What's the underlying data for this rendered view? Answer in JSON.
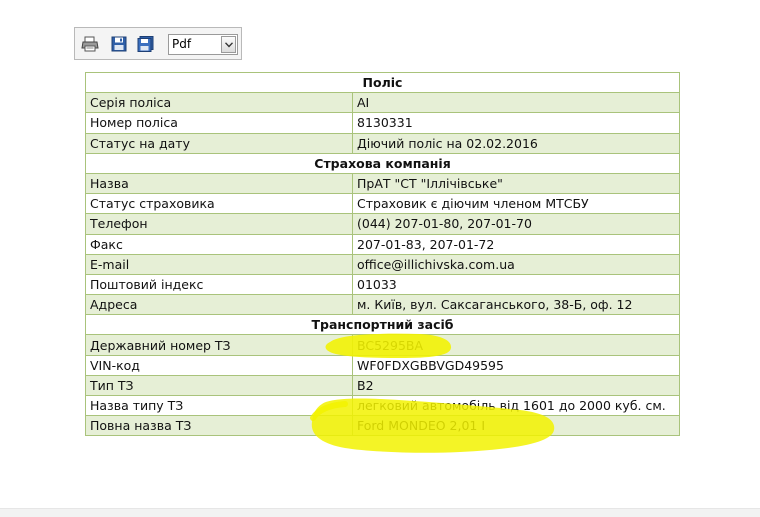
{
  "toolbar": {
    "buttons": [
      {
        "icon": "printer-icon"
      },
      {
        "icon": "save-icon"
      },
      {
        "icon": "save-as-icon"
      }
    ],
    "format": {
      "selected": "Pdf"
    }
  },
  "sections": [
    {
      "title": "Поліс",
      "rows": [
        {
          "label": "Серія поліса",
          "value": "AI"
        },
        {
          "label": "Номер поліса",
          "value": "8130331"
        },
        {
          "label": "Статус на дату",
          "value": "Діючий поліс на 02.02.2016"
        }
      ]
    },
    {
      "title": "Страхова компанія",
      "rows": [
        {
          "label": "Назва",
          "value": "ПрАТ \"СТ \"Іллічівське\""
        },
        {
          "label": "Статус страховика",
          "value": "Страховик є діючим членом МТСБУ"
        },
        {
          "label": "Телефон",
          "value": "(044) 207-01-80, 207-01-70"
        },
        {
          "label": "Факс",
          "value": "207-01-83, 207-01-72"
        },
        {
          "label": "E-mail",
          "value": "office@illichivska.com.ua"
        },
        {
          "label": "Поштовий індекс",
          "value": "01033"
        },
        {
          "label": "Адреса",
          "value": "м. Київ, вул. Саксаганського, 38-Б, оф. 12"
        }
      ]
    },
    {
      "title": "Транспортний засіб",
      "rows": [
        {
          "label": "Державний номер ТЗ",
          "value": "BC5295BA"
        },
        {
          "label": "VIN-код",
          "value": "WF0FDXGBBVGD49595"
        },
        {
          "label": "Тип ТЗ",
          "value": "B2"
        },
        {
          "label": "Назва типу ТЗ",
          "value": "легковий автомобіль від 1601 до 2000 куб. см."
        },
        {
          "label": "Повна назва ТЗ",
          "value": "Ford MONDEO 2,01 I"
        }
      ]
    }
  ],
  "colors": {
    "odd_row": "#e6efd6",
    "border": "#a9c37b",
    "highlighter": "#f2f200"
  }
}
